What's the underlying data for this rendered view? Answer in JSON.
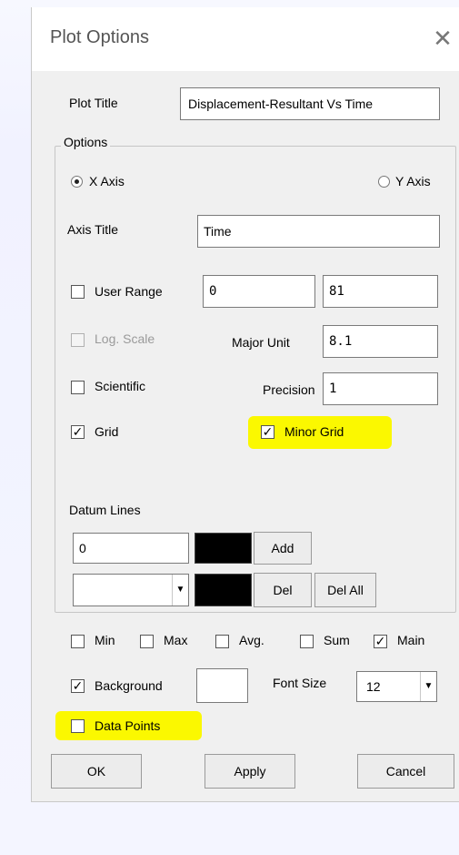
{
  "dialog": {
    "title": "Plot Options"
  },
  "plot_title": {
    "label": "Plot Title",
    "value": "Displacement-Resultant Vs Time"
  },
  "options": {
    "group_label": "Options",
    "axis_x": {
      "label": "X Axis",
      "selected": true
    },
    "axis_y": {
      "label": "Y Axis",
      "selected": false
    },
    "axis_title": {
      "label": "Axis Title",
      "value": "Time"
    },
    "user_range": {
      "label": "User Range",
      "checked": false,
      "min": "0",
      "max": "81"
    },
    "log_scale": {
      "label": "Log. Scale",
      "checked": false,
      "enabled": false
    },
    "major_unit": {
      "label": "Major Unit",
      "value": "8.1"
    },
    "scientific": {
      "label": "Scientific",
      "checked": false
    },
    "precision": {
      "label": "Precision",
      "value": "1"
    },
    "grid": {
      "label": "Grid",
      "checked": true
    },
    "minor_grid": {
      "label": "Minor Grid",
      "checked": true,
      "highlight_color": "#fbf800"
    },
    "datum": {
      "label": "Datum Lines",
      "value": "0",
      "swatch_color": "#000000",
      "add_label": "Add",
      "del_label": "Del",
      "del_all_label": "Del All",
      "combo_value": ""
    }
  },
  "series": {
    "min": {
      "label": "Min",
      "checked": false
    },
    "max": {
      "label": "Max",
      "checked": false
    },
    "avg": {
      "label": "Avg.",
      "checked": false
    },
    "sum": {
      "label": "Sum",
      "checked": false
    },
    "main": {
      "label": "Main",
      "checked": true
    }
  },
  "background": {
    "label": "Background",
    "checked": true,
    "swatch_color": "#ffffff"
  },
  "font_size": {
    "label": "Font Size",
    "value": "12"
  },
  "data_points": {
    "label": "Data Points",
    "checked": false,
    "highlight_color": "#fbf800"
  },
  "buttons": {
    "ok": "OK",
    "apply": "Apply",
    "cancel": "Cancel"
  },
  "icons": {
    "close": "close-icon",
    "dropdown": "chevron-down-icon",
    "check": "checkmark-icon"
  }
}
